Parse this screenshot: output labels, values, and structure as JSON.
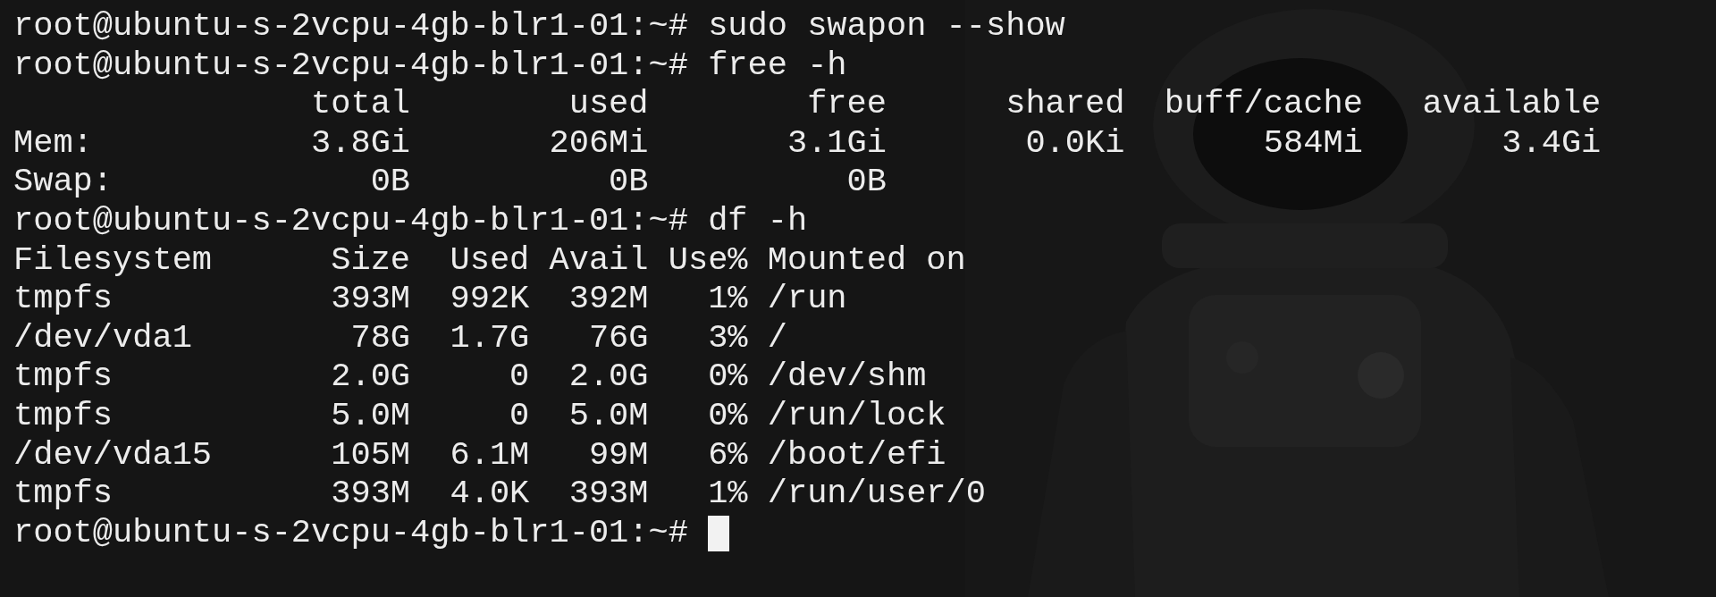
{
  "terminal": {
    "lines": [
      {
        "kind": "prompt",
        "prompt": "root@ubuntu-s-2vcpu-4gb-blr1-01:~#",
        "command": "sudo swapon --show",
        "cursor": false
      },
      {
        "kind": "prompt",
        "prompt": "root@ubuntu-s-2vcpu-4gb-blr1-01:~#",
        "command": "free -h",
        "cursor": false
      },
      {
        "kind": "output",
        "text": "               total        used        free      shared  buff/cache   available"
      },
      {
        "kind": "output",
        "text": "Mem:           3.8Gi       206Mi       3.1Gi       0.0Ki       584Mi       3.4Gi"
      },
      {
        "kind": "output",
        "text": "Swap:             0B          0B          0B"
      },
      {
        "kind": "prompt",
        "prompt": "root@ubuntu-s-2vcpu-4gb-blr1-01:~#",
        "command": "df -h",
        "cursor": false
      },
      {
        "kind": "output",
        "text": "Filesystem      Size  Used Avail Use% Mounted on"
      },
      {
        "kind": "output",
        "text": "tmpfs           393M  992K  392M   1% /run"
      },
      {
        "kind": "output",
        "text": "/dev/vda1        78G  1.7G   76G   3% /"
      },
      {
        "kind": "output",
        "text": "tmpfs           2.0G     0  2.0G   0% /dev/shm"
      },
      {
        "kind": "output",
        "text": "tmpfs           5.0M     0  5.0M   0% /run/lock"
      },
      {
        "kind": "output",
        "text": "/dev/vda15      105M  6.1M   99M   6% /boot/efi"
      },
      {
        "kind": "output",
        "text": "tmpfs           393M  4.0K  393M   1% /run/user/0"
      },
      {
        "kind": "prompt",
        "prompt": "root@ubuntu-s-2vcpu-4gb-blr1-01:~#",
        "cursor": true
      }
    ]
  }
}
